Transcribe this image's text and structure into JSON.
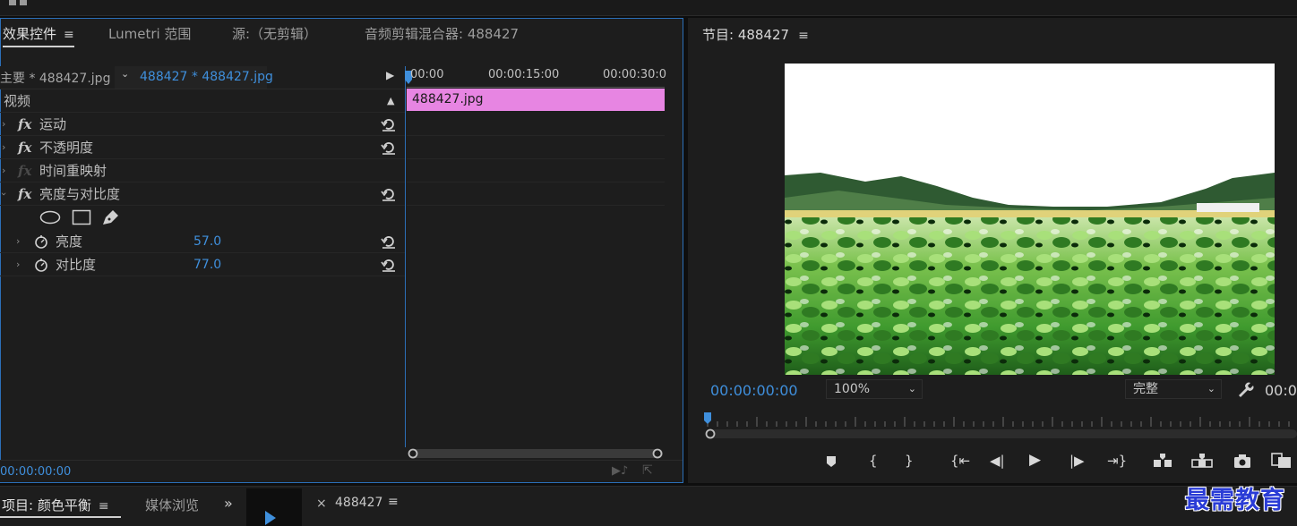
{
  "effect_controls": {
    "tabs": [
      "效果控件",
      "Lumetri 范围",
      "源:（无剪辑）",
      "音频剪辑混合器: 488427"
    ],
    "master_label": "主要 * 488427.jpg",
    "sequence_clip_label": "488427 * 488427.jpg",
    "video_section_label": "视频",
    "fx_items": [
      "运动",
      "不透明度",
      "时间重映射",
      "亮度与对比度"
    ],
    "params": [
      {
        "label": "亮度",
        "value": "57.0"
      },
      {
        "label": "对比度",
        "value": "77.0"
      }
    ],
    "timecodes": [
      "00:00",
      "00:00:15:00",
      "00:00:30:0"
    ],
    "clip_name": "488427.jpg",
    "current_time": "00:00:00:00"
  },
  "program": {
    "title": "节目: 488427",
    "timecode": "00:00:00:00",
    "zoom": "100%",
    "quality": "完整",
    "duration_partial": "00:0"
  },
  "bottom": {
    "project_tab": "项目: 颜色平衡",
    "media_tab": "媒体浏览",
    "sequence_tab": "488427"
  },
  "watermark": "最需教育",
  "colors": {
    "accent_blue": "#3f8fdc",
    "clip_pink": "#e785e2",
    "panel_bg": "#1d1d1d",
    "border_blue": "#2b6fb8"
  }
}
